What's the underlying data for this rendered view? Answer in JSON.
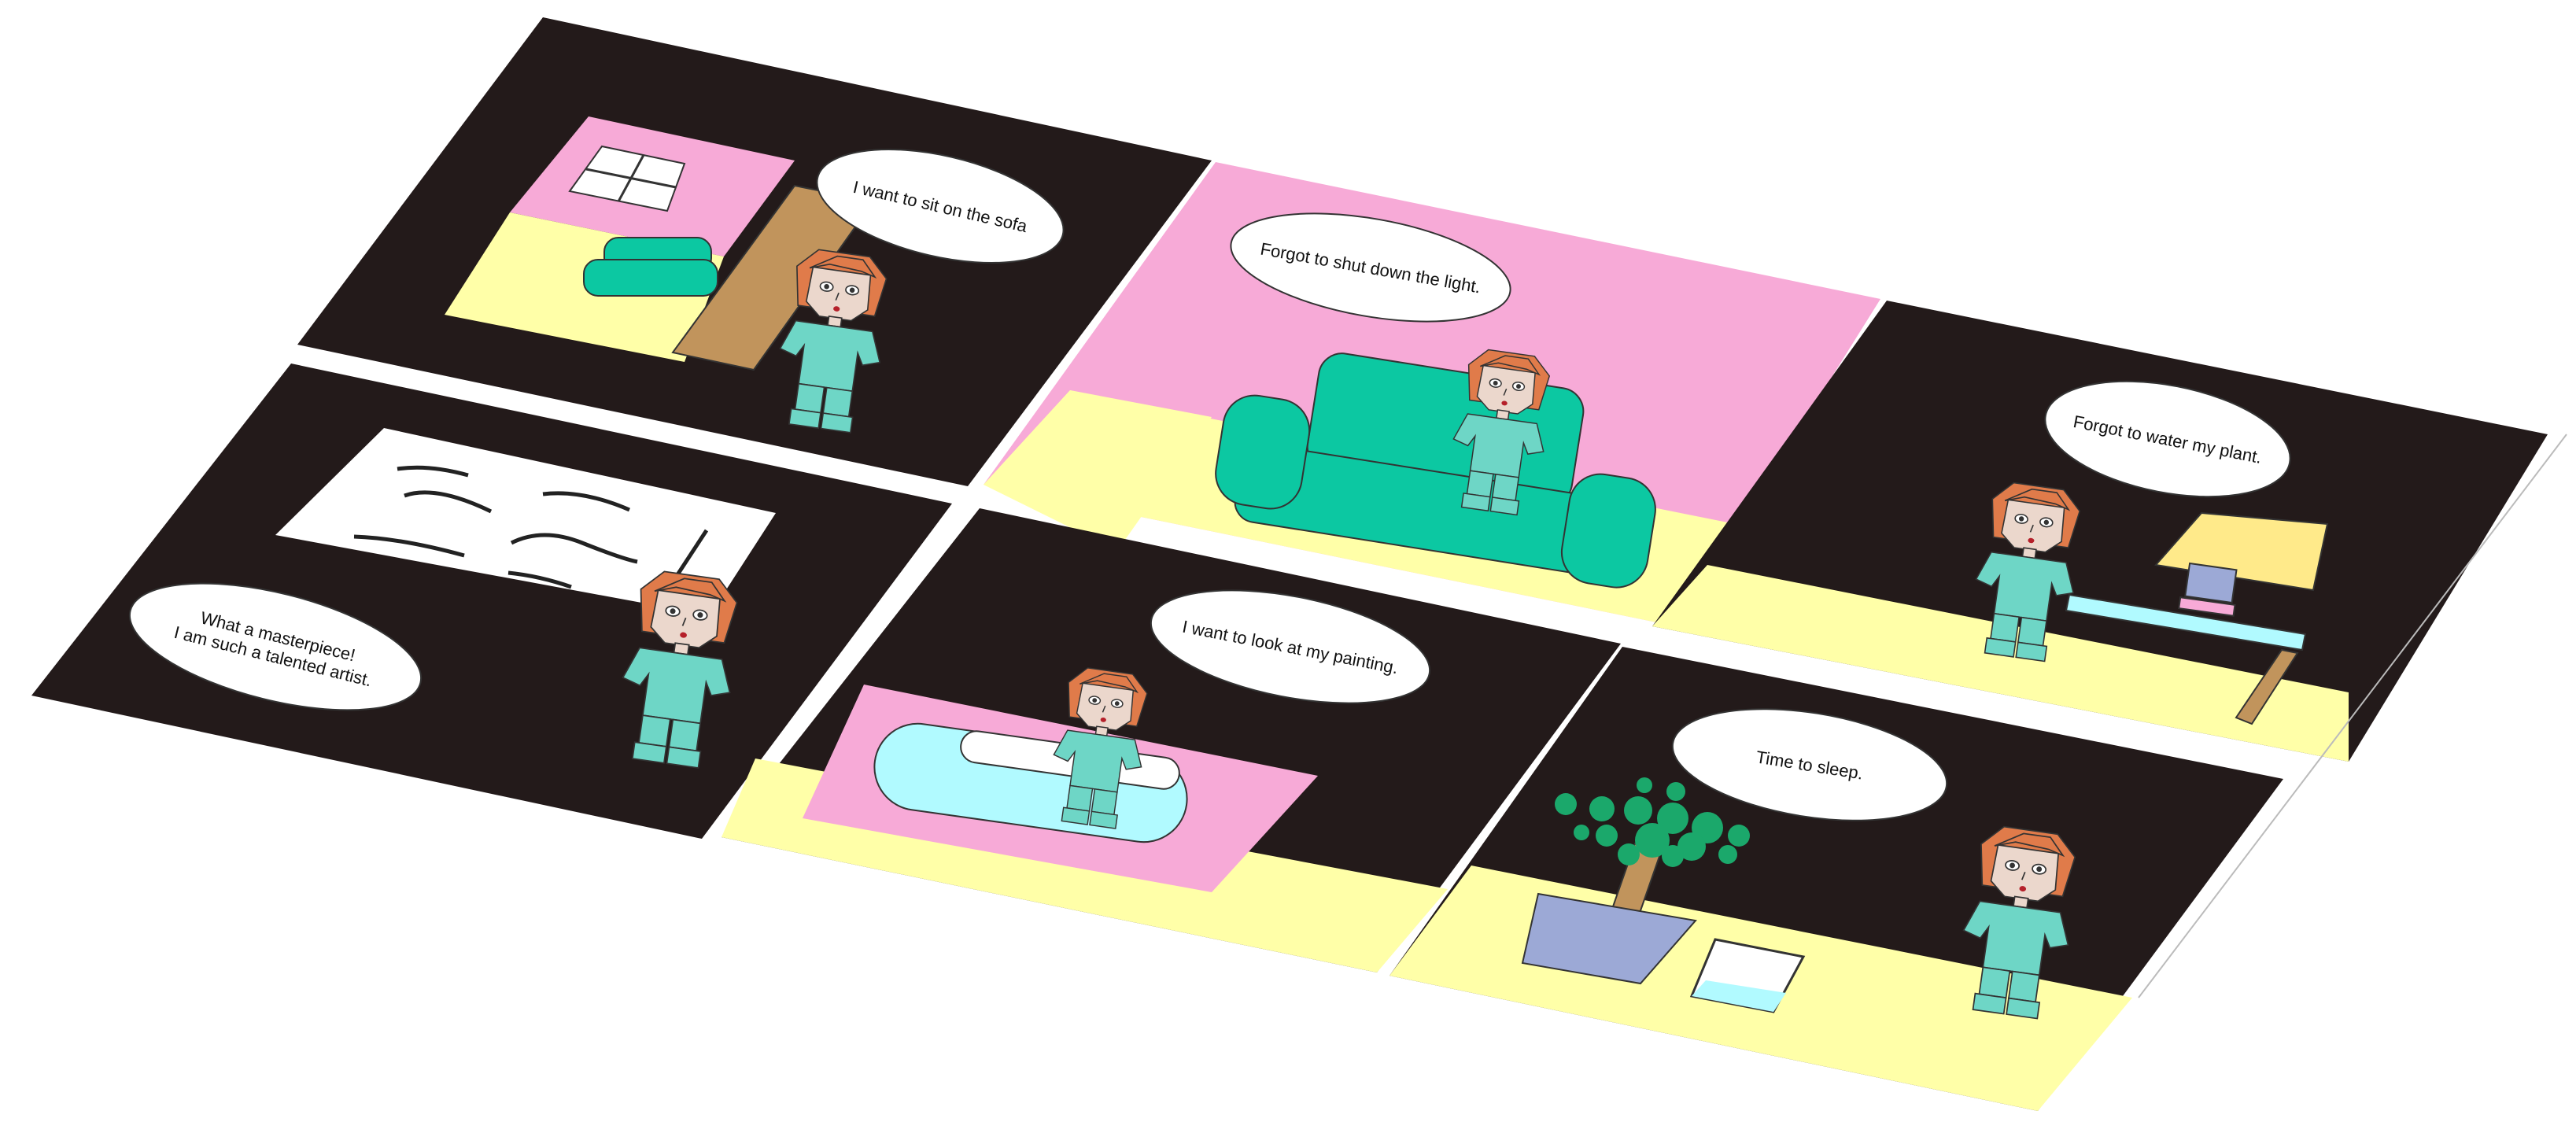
{
  "comic": {
    "panels": [
      {
        "id": "p1",
        "caption": "I want to sit on the sofa"
      },
      {
        "id": "p2",
        "caption": "Forgot to shut down the light."
      },
      {
        "id": "p3",
        "caption": "Forgot to water my plant."
      },
      {
        "id": "p4",
        "caption_line1": "What a masterpiece!",
        "caption_line2": "I am such a talented artist."
      },
      {
        "id": "p5",
        "caption": "I want to look at my painting."
      },
      {
        "id": "p6",
        "caption": "Time to sleep."
      }
    ],
    "colors": {
      "dark": "#231A1A",
      "pink": "#F7AAD7",
      "yellow": "#FFFFA8",
      "teal": "#0CC8A2",
      "shirt": "#6ED6C6",
      "hair": "#E07B4A",
      "skin": "#EBD7CC",
      "brown": "#C1945C",
      "lamp": "#FFEA8A",
      "pillow": "#B1FAFF",
      "pot": "#9CA9D6",
      "leaf": "#1BA86B"
    }
  }
}
